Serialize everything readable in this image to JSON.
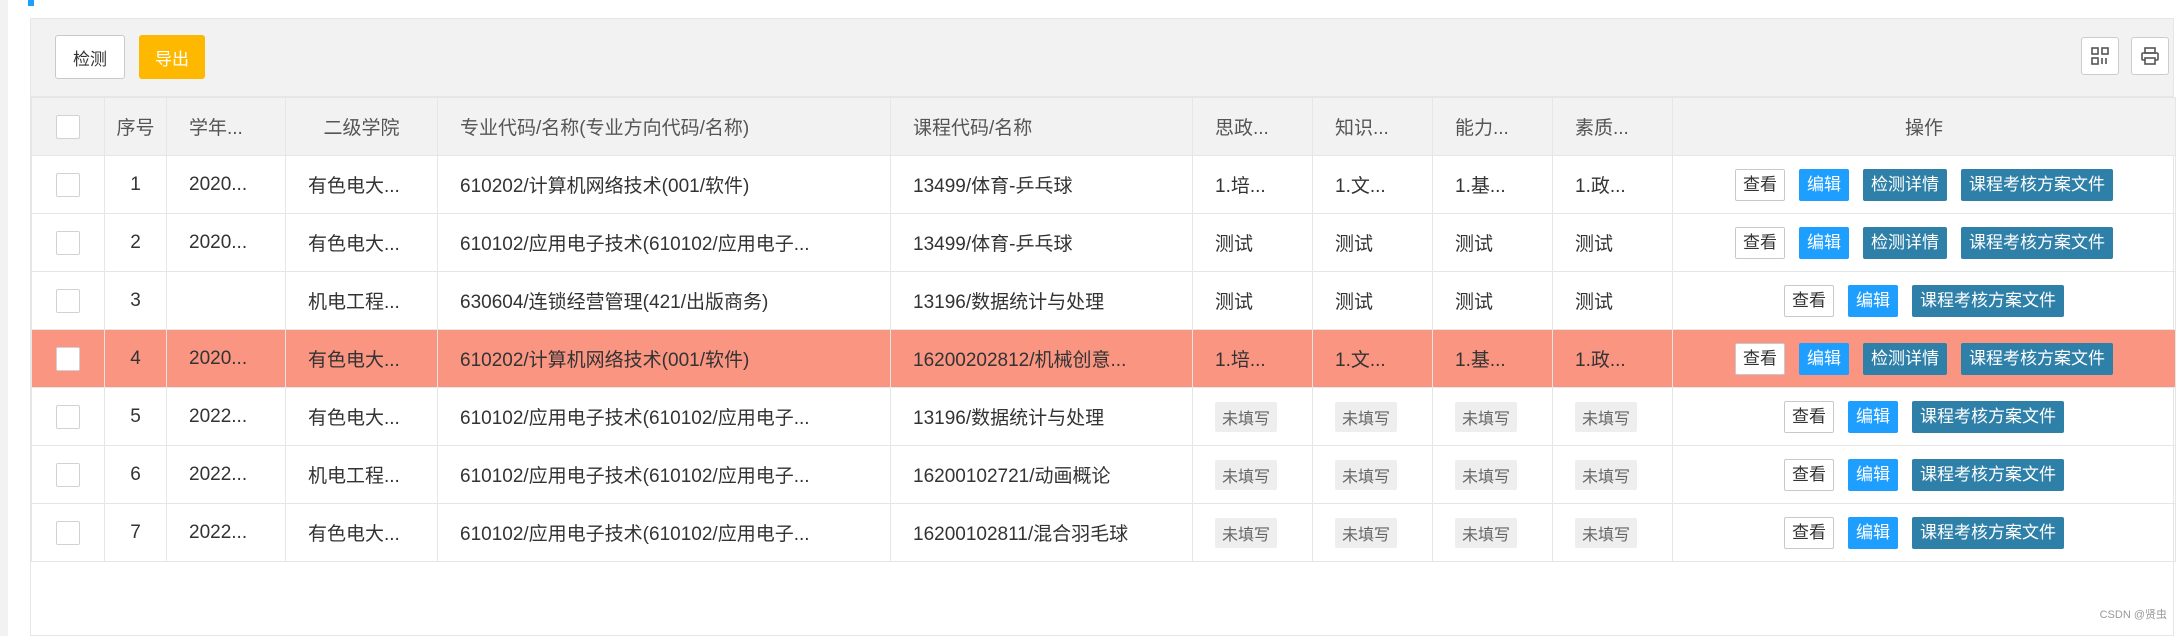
{
  "toolbar": {
    "detect_label": "检测",
    "export_label": "导出"
  },
  "table": {
    "headers": {
      "index": "序号",
      "year": "学年...",
      "college": "二级学院",
      "major": "专业代码/名称(专业方向代码/名称)",
      "course": "课程代码/名称",
      "ideology": "思政...",
      "knowledge": "知识...",
      "ability": "能力...",
      "quality": "素质...",
      "ops": "操作"
    },
    "op_labels": {
      "view": "查看",
      "edit": "编辑",
      "detail": "检测详情",
      "file": "课程考核方案文件"
    },
    "rows": [
      {
        "index": "1",
        "year": "2020...",
        "college": "有色电大...",
        "major": "610202/计算机网络技术(001/软件)",
        "course": "13499/体育-乒乓球",
        "ideology": "1.培...",
        "knowledge": "1.文...",
        "ability": "1.基...",
        "quality": "1.政...",
        "filled": true,
        "has_detail": true,
        "highlight": false
      },
      {
        "index": "2",
        "year": "2020...",
        "college": "有色电大...",
        "major": "610102/应用电子技术(610102/应用电子...",
        "course": "13499/体育-乒乓球",
        "ideology": "测试",
        "knowledge": "测试",
        "ability": "测试",
        "quality": "测试",
        "filled": true,
        "has_detail": true,
        "highlight": false
      },
      {
        "index": "3",
        "year": "",
        "college": "机电工程...",
        "major": "630604/连锁经营管理(421/出版商务)",
        "course": "13196/数据统计与处理",
        "ideology": "测试",
        "knowledge": "测试",
        "ability": "测试",
        "quality": "测试",
        "filled": true,
        "has_detail": false,
        "highlight": false
      },
      {
        "index": "4",
        "year": "2020...",
        "college": "有色电大...",
        "major": "610202/计算机网络技术(001/软件)",
        "course": "16200202812/机械创意...",
        "ideology": "1.培...",
        "knowledge": "1.文...",
        "ability": "1.基...",
        "quality": "1.政...",
        "filled": true,
        "has_detail": true,
        "highlight": true
      },
      {
        "index": "5",
        "year": "2022...",
        "college": "有色电大...",
        "major": "610102/应用电子技术(610102/应用电子...",
        "course": "13196/数据统计与处理",
        "ideology": "未填写",
        "knowledge": "未填写",
        "ability": "未填写",
        "quality": "未填写",
        "filled": false,
        "has_detail": false,
        "highlight": false
      },
      {
        "index": "6",
        "year": "2022...",
        "college": "机电工程...",
        "major": "610102/应用电子技术(610102/应用电子...",
        "course": "16200102721/动画概论",
        "ideology": "未填写",
        "knowledge": "未填写",
        "ability": "未填写",
        "quality": "未填写",
        "filled": false,
        "has_detail": false,
        "highlight": false
      },
      {
        "index": "7",
        "year": "2022...",
        "college": "有色电大...",
        "major": "610102/应用电子技术(610102/应用电子...",
        "course": "16200102811/混合羽毛球",
        "ideology": "未填写",
        "knowledge": "未填写",
        "ability": "未填写",
        "quality": "未填写",
        "filled": false,
        "has_detail": false,
        "highlight": false
      }
    ]
  },
  "watermark": "CSDN @贤虫",
  "colors": {
    "highlight_row": "#fa9582",
    "export_button": "#ffb800",
    "edit_button": "#1e9fff",
    "action_button": "#2f80a8"
  }
}
